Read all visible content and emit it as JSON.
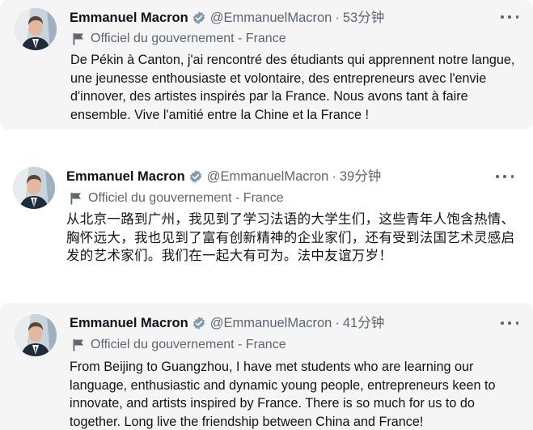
{
  "colors": {
    "card_shaded": "#f5f5f6",
    "text": "#0f1419",
    "secondary": "#5b6670",
    "verified_badge": "#829aab"
  },
  "tweets": [
    {
      "author_name": "Emmanuel Macron",
      "verified_icon": "verified-badge-icon",
      "handle": "@EmmanuelMacron",
      "separator": "·",
      "time": "53分钟",
      "label_icon": "flag-icon",
      "label": "Officiel du gouvernement - France",
      "text": "De Pékin à Canton, j'ai rencontré des étudiants qui apprennent notre langue,\nune jeunesse enthousiaste et volontaire, des entrepreneurs avec l'envie\nd'innover, des artistes inspirés par la France. Nous avons tant à faire\nensemble. Vive l'amitié entre la Chine et la France !"
    },
    {
      "author_name": "Emmanuel Macron",
      "verified_icon": "verified-badge-icon",
      "handle": "@EmmanuelMacron",
      "separator": "·",
      "time": "39分钟",
      "label_icon": "flag-icon",
      "label": "Officiel du gouvernement - France",
      "text": "从北京一路到广州，我见到了学习法语的大学生们，这些青年人饱含热情、\n胸怀远大，我也见到了富有创新精神的企业家们，还有受到法国艺术灵感启\n发的艺术家们。我们在一起大有可为。法中友谊万岁！"
    },
    {
      "author_name": "Emmanuel Macron",
      "verified_icon": "verified-badge-icon",
      "handle": "@EmmanuelMacron",
      "separator": "·",
      "time": "41分钟",
      "label_icon": "flag-icon",
      "label": "Officiel du gouvernement - France",
      "text": "From Beijing to Guangzhou, I have met students who are learning our\nlanguage, enthusiastic and dynamic young people, entrepreneurs keen to\ninnovate, and artists inspired by France. There is so much for us to do\ntogether. Long live the friendship between China and France!"
    }
  ]
}
